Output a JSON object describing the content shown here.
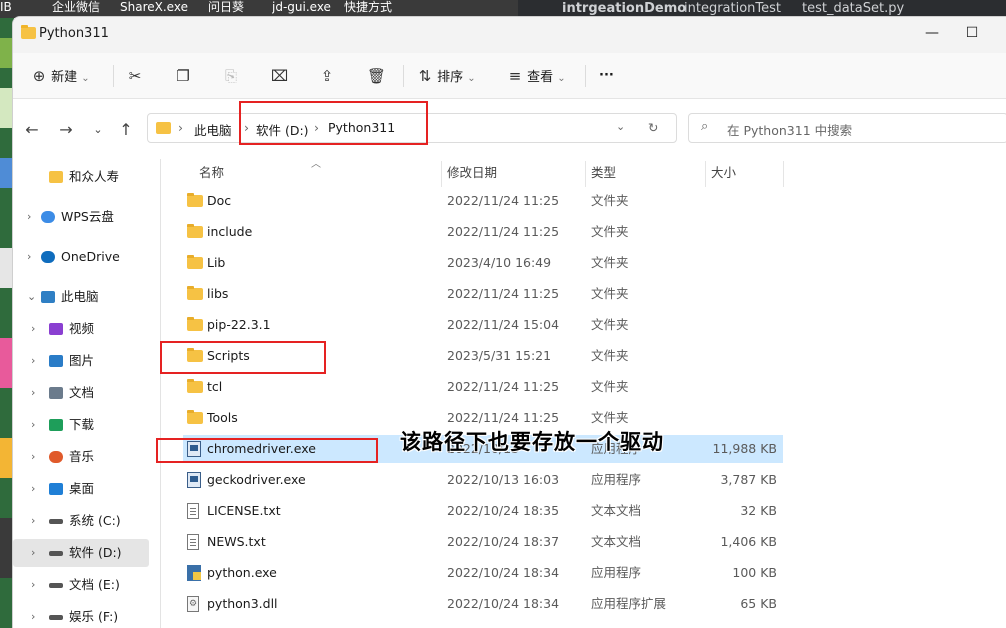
{
  "background": {
    "taskbar_items": [
      "IB",
      "企业微信",
      "ShareX.exe",
      "问日葵",
      "jd-gui.exe",
      "快捷方式"
    ],
    "ide_tabs": [
      "intrgeationDemo",
      "integrationTest",
      "test_dataSet.py"
    ]
  },
  "window": {
    "title": "Python311",
    "controls": {
      "minimize": "—",
      "maximize": "☐"
    }
  },
  "toolbar": {
    "new_label": "新建",
    "sort_label": "排序",
    "view_label": "查看",
    "more_label": "···"
  },
  "address": {
    "crumbs": [
      "此电脑",
      "软件 (D:)",
      "Python311"
    ],
    "search_placeholder": "在 Python311 中搜索"
  },
  "sidebar": {
    "items": [
      {
        "label": "和众人寿",
        "icon": "folder-icon"
      },
      {
        "label": "WPS云盘",
        "icon": "cloud-icon"
      },
      {
        "label": "OneDrive",
        "icon": "onedrive-icon"
      },
      {
        "label": "此电脑",
        "icon": "pc-icon"
      },
      {
        "label": "视频",
        "icon": "video-icon"
      },
      {
        "label": "图片",
        "icon": "picture-icon"
      },
      {
        "label": "文档",
        "icon": "document-icon"
      },
      {
        "label": "下载",
        "icon": "download-icon"
      },
      {
        "label": "音乐",
        "icon": "music-icon"
      },
      {
        "label": "桌面",
        "icon": "desktop-icon"
      },
      {
        "label": "系统 (C:)",
        "icon": "drive-icon"
      },
      {
        "label": "软件 (D:)",
        "icon": "drive-icon"
      },
      {
        "label": "文档 (E:)",
        "icon": "drive-icon"
      },
      {
        "label": "娱乐 (F:)",
        "icon": "drive-icon"
      }
    ]
  },
  "columns": {
    "name": "名称",
    "date": "修改日期",
    "type": "类型",
    "size": "大小"
  },
  "files": [
    {
      "name": "Doc",
      "date": "2022/11/24 11:25",
      "type": "文件夹",
      "size": "",
      "icon": "folder"
    },
    {
      "name": "include",
      "date": "2022/11/24 11:25",
      "type": "文件夹",
      "size": "",
      "icon": "folder"
    },
    {
      "name": "Lib",
      "date": "2023/4/10 16:49",
      "type": "文件夹",
      "size": "",
      "icon": "folder"
    },
    {
      "name": "libs",
      "date": "2022/11/24 11:25",
      "type": "文件夹",
      "size": "",
      "icon": "folder"
    },
    {
      "name": "pip-22.3.1",
      "date": "2022/11/24 15:04",
      "type": "文件夹",
      "size": "",
      "icon": "folder"
    },
    {
      "name": "Scripts",
      "date": "2023/5/31 15:21",
      "type": "文件夹",
      "size": "",
      "icon": "folder"
    },
    {
      "name": "tcl",
      "date": "2022/11/24 11:25",
      "type": "文件夹",
      "size": "",
      "icon": "folder"
    },
    {
      "name": "Tools",
      "date": "2022/11/24 11:25",
      "type": "文件夹",
      "size": "",
      "icon": "folder"
    },
    {
      "name": "chromedriver.exe",
      "date": "2022/10/13",
      "type": "应用程序",
      "size": "11,988 KB",
      "icon": "exe"
    },
    {
      "name": "geckodriver.exe",
      "date": "2022/10/13 16:03",
      "type": "应用程序",
      "size": "3,787 KB",
      "icon": "exe"
    },
    {
      "name": "LICENSE.txt",
      "date": "2022/10/24 18:35",
      "type": "文本文档",
      "size": "32 KB",
      "icon": "txt"
    },
    {
      "name": "NEWS.txt",
      "date": "2022/10/24 18:37",
      "type": "文本文档",
      "size": "1,406 KB",
      "icon": "txt"
    },
    {
      "name": "python.exe",
      "date": "2022/10/24 18:34",
      "type": "应用程序",
      "size": "100 KB",
      "icon": "py"
    },
    {
      "name": "python3.dll",
      "date": "2022/10/24 18:34",
      "type": "应用程序扩展",
      "size": "65 KB",
      "icon": "dll"
    }
  ],
  "annotation": {
    "text": "该路径下也要存放一个驱动",
    "color": "#e52222"
  },
  "colors": {
    "selection": "#cce8ff",
    "folder": "#f6c244",
    "highlight_box": "#e52222"
  }
}
